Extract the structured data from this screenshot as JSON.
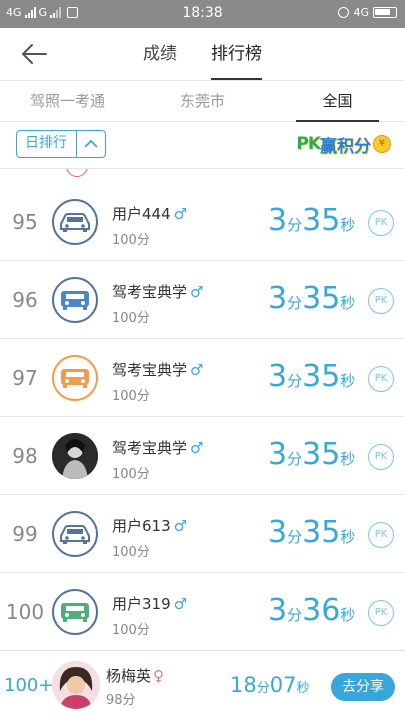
{
  "status_bar": {
    "left_text_1": "4G",
    "left_text_2": "G",
    "time": "18:38",
    "right_text": "4G"
  },
  "header": {
    "tabs": [
      {
        "label": "成绩"
      },
      {
        "label": "排行榜"
      }
    ]
  },
  "region_tabs": [
    {
      "label": "驾照一考通"
    },
    {
      "label": "东莞市"
    },
    {
      "label": "全国"
    }
  ],
  "filter": {
    "period_label": "日排行",
    "promo_pk": "PK",
    "promo_text": "赢积分",
    "promo_coin": "¥"
  },
  "rows": [
    {
      "rank": "95",
      "name": "用户444",
      "gender": "♂",
      "score": "100分",
      "min": "3",
      "min_unit": "分",
      "sec": "35",
      "sec_unit": "秒",
      "pk": "PK",
      "avatar": "car-icon-blue"
    },
    {
      "rank": "96",
      "name": "驾考宝典学",
      "gender": "♂",
      "score": "100分",
      "min": "3",
      "min_unit": "分",
      "sec": "35",
      "sec_unit": "秒",
      "pk": "PK",
      "avatar": "car-icon-blue"
    },
    {
      "rank": "97",
      "name": "驾考宝典学",
      "gender": "♂",
      "score": "100分",
      "min": "3",
      "min_unit": "分",
      "sec": "35",
      "sec_unit": "秒",
      "pk": "PK",
      "avatar": "car-icon-orange"
    },
    {
      "rank": "98",
      "name": "驾考宝典学",
      "gender": "♂",
      "score": "100分",
      "min": "3",
      "min_unit": "分",
      "sec": "35",
      "sec_unit": "秒",
      "pk": "PK",
      "avatar": "photo"
    },
    {
      "rank": "99",
      "name": "用户613",
      "gender": "♂",
      "score": "100分",
      "min": "3",
      "min_unit": "分",
      "sec": "35",
      "sec_unit": "秒",
      "pk": "PK",
      "avatar": "car-icon-blue"
    },
    {
      "rank": "100",
      "name": "用户319",
      "gender": "♂",
      "score": "100分",
      "min": "3",
      "min_unit": "分",
      "sec": "36",
      "sec_unit": "秒",
      "pk": "PK",
      "avatar": "car-icon-green"
    }
  ],
  "me": {
    "rank": "100+",
    "name": "杨梅英",
    "gender": "♀",
    "score": "98分",
    "min": "18",
    "min_unit": "分",
    "sec": "07",
    "sec_unit": "秒",
    "share_label": "去分享"
  },
  "colors": {
    "accent": "#3aa7d8",
    "avatar_border_blue": "#56739a",
    "avatar_border_orange": "#ef9d4a",
    "status_bar": "#8a8a8a"
  }
}
